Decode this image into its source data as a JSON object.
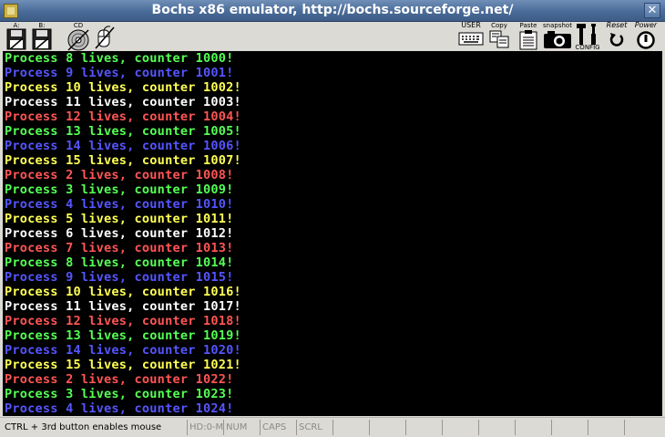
{
  "window": {
    "title": "Bochs x86 emulator, http://bochs.sourceforge.net/",
    "close_glyph": "✕"
  },
  "toolbar": {
    "floppy_a": "A:",
    "floppy_b": "B:",
    "cdrom": "CD",
    "user": "USER",
    "copy": "Copy",
    "paste": "Paste",
    "snapshot": "snapshot",
    "config": "CONFIG",
    "reset": "Reset",
    "power": "Power"
  },
  "console": {
    "lines": [
      {
        "text": "Process 8 lives, counter 1000!",
        "color": "#55ff55"
      },
      {
        "text": "Process 9 lives, counter 1001!",
        "color": "#5555ff"
      },
      {
        "text": "Process 10 lives, counter 1002!",
        "color": "#ffff55"
      },
      {
        "text": "Process 11 lives, counter 1003!",
        "color": "#ffffff"
      },
      {
        "text": "Process 12 lives, counter 1004!",
        "color": "#ff5555"
      },
      {
        "text": "Process 13 lives, counter 1005!",
        "color": "#55ff55"
      },
      {
        "text": "Process 14 lives, counter 1006!",
        "color": "#5555ff"
      },
      {
        "text": "Process 15 lives, counter 1007!",
        "color": "#ffff55"
      },
      {
        "text": "Process 2 lives, counter 1008!",
        "color": "#ff5555"
      },
      {
        "text": "Process 3 lives, counter 1009!",
        "color": "#55ff55"
      },
      {
        "text": "Process 4 lives, counter 1010!",
        "color": "#5555ff"
      },
      {
        "text": "Process 5 lives, counter 1011!",
        "color": "#ffff55"
      },
      {
        "text": "Process 6 lives, counter 1012!",
        "color": "#ffffff"
      },
      {
        "text": "Process 7 lives, counter 1013!",
        "color": "#ff5555"
      },
      {
        "text": "Process 8 lives, counter 1014!",
        "color": "#55ff55"
      },
      {
        "text": "Process 9 lives, counter 1015!",
        "color": "#5555ff"
      },
      {
        "text": "Process 10 lives, counter 1016!",
        "color": "#ffff55"
      },
      {
        "text": "Process 11 lives, counter 1017!",
        "color": "#ffffff"
      },
      {
        "text": "Process 12 lives, counter 1018!",
        "color": "#ff5555"
      },
      {
        "text": "Process 13 lives, counter 1019!",
        "color": "#55ff55"
      },
      {
        "text": "Process 14 lives, counter 1020!",
        "color": "#5555ff"
      },
      {
        "text": "Process 15 lives, counter 1021!",
        "color": "#ffff55"
      },
      {
        "text": "Process 2 lives, counter 1022!",
        "color": "#ff5555"
      },
      {
        "text": "Process 3 lives, counter 1023!",
        "color": "#55ff55"
      },
      {
        "text": "Process 4 lives, counter 1024!",
        "color": "#5555ff"
      }
    ]
  },
  "statusbar": {
    "hint": "CTRL + 3rd button enables mouse",
    "hd": "HD:0-M",
    "num": "NUM",
    "caps": "CAPS",
    "scrl": "SCRL"
  }
}
